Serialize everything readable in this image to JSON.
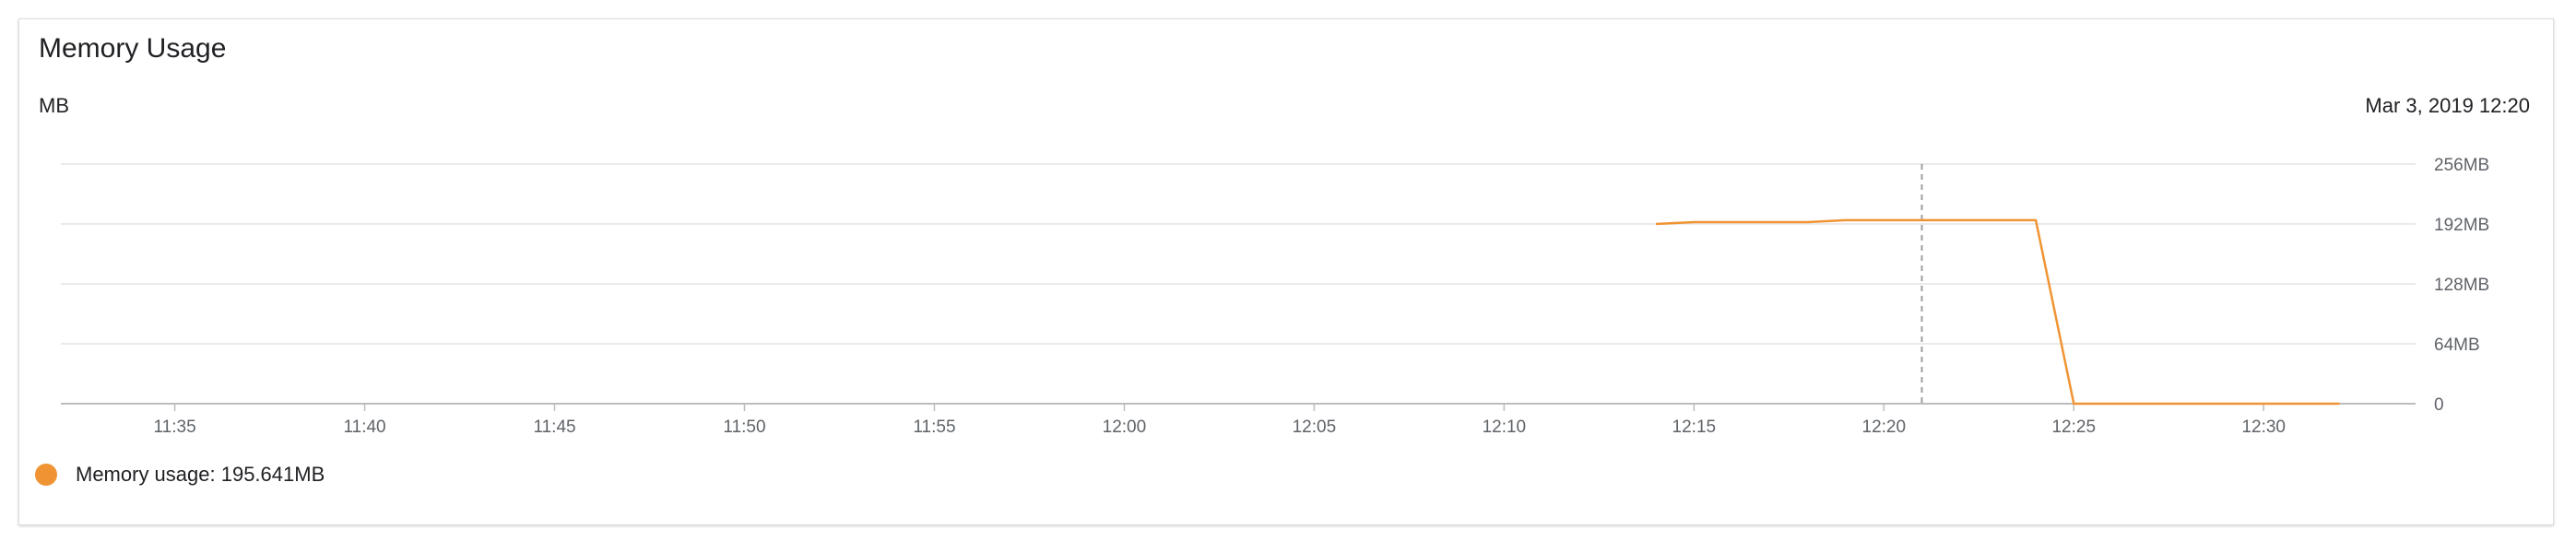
{
  "card": {
    "title": "Memory Usage",
    "unit": "MB",
    "hover_timestamp": "Mar 3, 2019 12:20"
  },
  "legend": {
    "label": "Memory usage: 195.641MB",
    "color": "#f09433"
  },
  "colors": {
    "series": "#f09433",
    "grid": "#e4e4e4",
    "axis": "#bdbdbd",
    "cursor": "#9e9e9e"
  },
  "chart_data": {
    "type": "line",
    "title": "Memory Usage",
    "ylabel": "MB",
    "ylim": [
      0,
      256
    ],
    "y_ticks": [
      {
        "value": 0,
        "label": "0"
      },
      {
        "value": 64,
        "label": "64MB"
      },
      {
        "value": 128,
        "label": "128MB"
      },
      {
        "value": 192,
        "label": "192MB"
      },
      {
        "value": 256,
        "label": "256MB"
      }
    ],
    "x_range": [
      "11:32",
      "12:34"
    ],
    "x_ticks": [
      "11:35",
      "11:40",
      "11:45",
      "11:50",
      "11:55",
      "12:00",
      "12:05",
      "12:10",
      "12:15",
      "12:20",
      "12:25",
      "12:30"
    ],
    "cursor_time": "12:21",
    "grid": true,
    "legend_position": "bottom-left",
    "series": [
      {
        "name": "Memory usage",
        "points": [
          {
            "x": "12:14",
            "y": 192
          },
          {
            "x": "12:15",
            "y": 194
          },
          {
            "x": "12:18",
            "y": 194
          },
          {
            "x": "12:19",
            "y": 196
          },
          {
            "x": "12:24",
            "y": 196
          },
          {
            "x": "12:25",
            "y": 0
          },
          {
            "x": "12:32",
            "y": 0
          }
        ]
      }
    ]
  }
}
